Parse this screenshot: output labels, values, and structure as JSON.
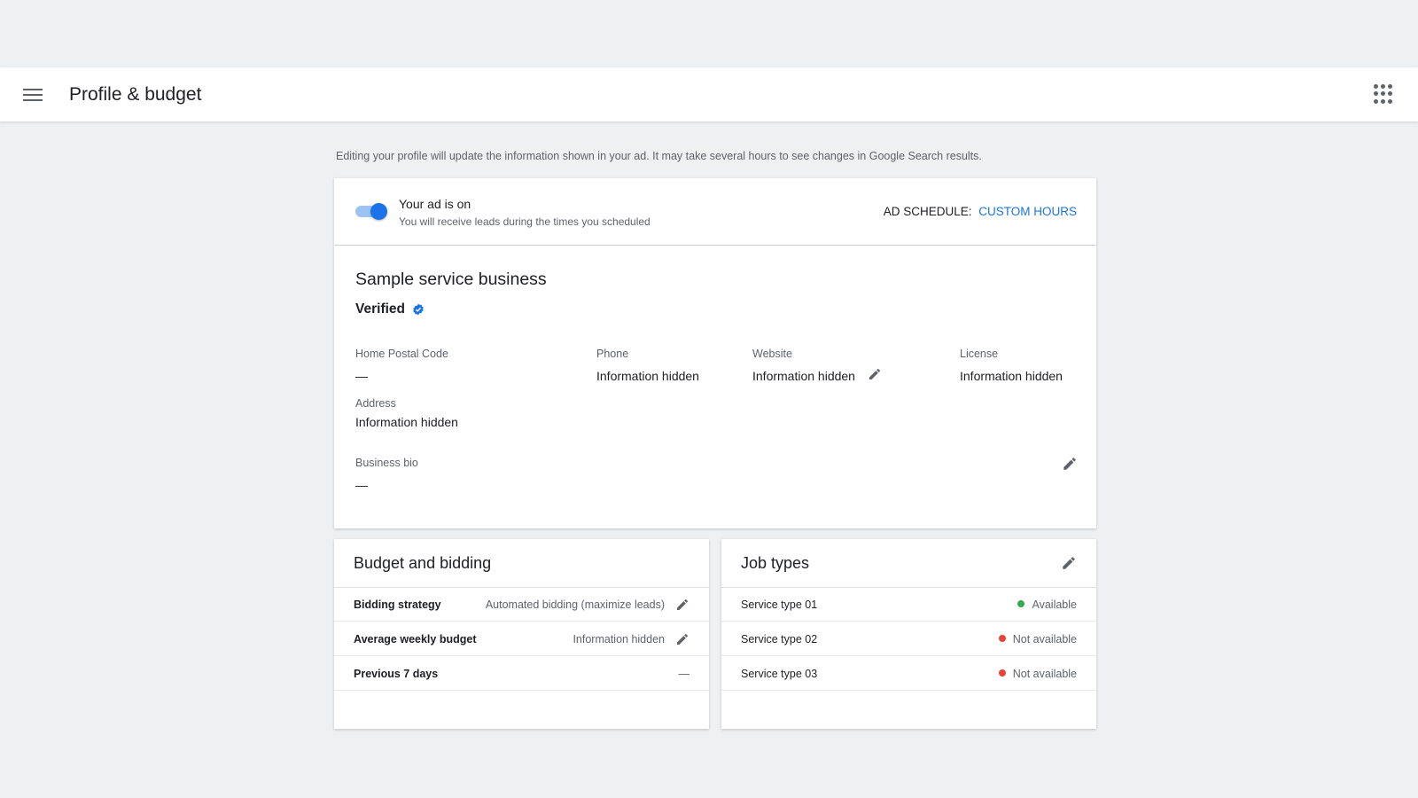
{
  "header": {
    "title": "Profile & budget",
    "menu_icon": "hamburger-menu-icon",
    "apps_icon": "apps-grid-icon"
  },
  "info_text": "Editing your profile will update the information shown in your ad. It may take several hours to see changes in Google Search results.",
  "ad_status": {
    "title": "Your ad is on",
    "subtitle": "You will receive leads during the times you scheduled",
    "toggle_on": true,
    "schedule_label": "AD SCHEDULE:",
    "schedule_value": "CUSTOM HOURS"
  },
  "business": {
    "name": "Sample service business",
    "verified_label": "Verified",
    "fields": {
      "postal": {
        "label": "Home Postal Code",
        "value": "—"
      },
      "phone": {
        "label": "Phone",
        "value": "Information hidden"
      },
      "website": {
        "label": "Website",
        "value": "Information hidden"
      },
      "license": {
        "label": "License",
        "value": "Information hidden"
      },
      "address": {
        "label": "Address",
        "value": "Information hidden"
      },
      "bio": {
        "label": "Business bio",
        "value": "—"
      }
    }
  },
  "budget": {
    "title": "Budget and bidding",
    "rows": [
      {
        "label": "Bidding strategy",
        "value": "Automated bidding (maximize leads)"
      },
      {
        "label": "Average weekly budget",
        "value": "Information hidden"
      },
      {
        "label": "Previous 7 days",
        "value": "—"
      }
    ]
  },
  "jobs": {
    "title": "Job types",
    "rows": [
      {
        "label": "Service type 01",
        "status": "Available",
        "color": "#34a853"
      },
      {
        "label": "Service type 02",
        "status": "Not available",
        "color": "#ea4335"
      },
      {
        "label": "Service type 03",
        "status": "Not available",
        "color": "#ea4335"
      }
    ]
  },
  "colors": {
    "accent": "#1a73e8",
    "available": "#34a853",
    "unavailable": "#ea4335"
  }
}
